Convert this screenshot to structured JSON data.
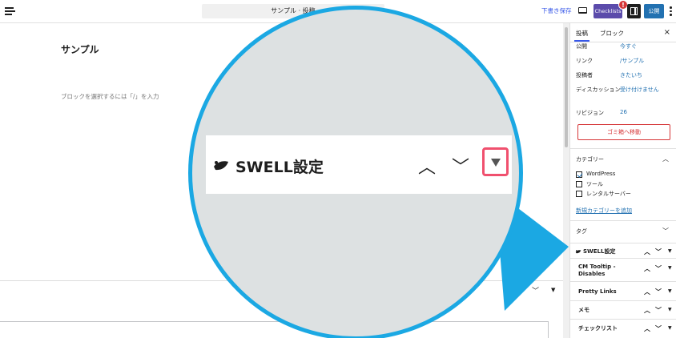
{
  "topbar": {
    "doc_title": "サンプル · 投稿",
    "save_draft": "下書き保存",
    "checklists": "Checklists",
    "badge": "!",
    "publish": "公開"
  },
  "editor": {
    "post_title": "サンプル",
    "block_placeholder": "ブロックを選択するには「/」を入力"
  },
  "sidebar": {
    "tabs": {
      "post": "投稿",
      "block": "ブロック"
    },
    "close": "×",
    "rows": [
      {
        "label": "公開",
        "value": "今すぐ"
      },
      {
        "label": "リンク",
        "value": "/サンプル"
      },
      {
        "label": "投稿者",
        "value": "きたいち"
      },
      {
        "label": "ディスカッション",
        "value": "受け付けません"
      },
      {
        "label": "リビジョン",
        "value": "26"
      }
    ],
    "trash_button": "ゴミ箱へ移動",
    "categories": {
      "title": "カテゴリー",
      "items": [
        {
          "label": "WordPress",
          "checked": true
        },
        {
          "label": "ツール",
          "checked": false
        },
        {
          "label": "レンタルサーバー",
          "checked": false
        }
      ],
      "add_new": "新規カテゴリーを追加"
    },
    "tags": {
      "title": "タグ"
    },
    "meta_boxes": [
      {
        "title": "SWELL設定"
      },
      {
        "title": "CM Tooltip - Disables"
      },
      {
        "title": "Pretty Links"
      },
      {
        "title": "メモ"
      },
      {
        "title": "チェックリスト"
      }
    ]
  },
  "magnifier": {
    "title": "SWELL設定"
  },
  "colors": {
    "accent": "#1ba8e3",
    "highlight": "#f0506e",
    "publish": "#2271b1",
    "checklists": "#5b4bab",
    "trash": "#d63638"
  }
}
